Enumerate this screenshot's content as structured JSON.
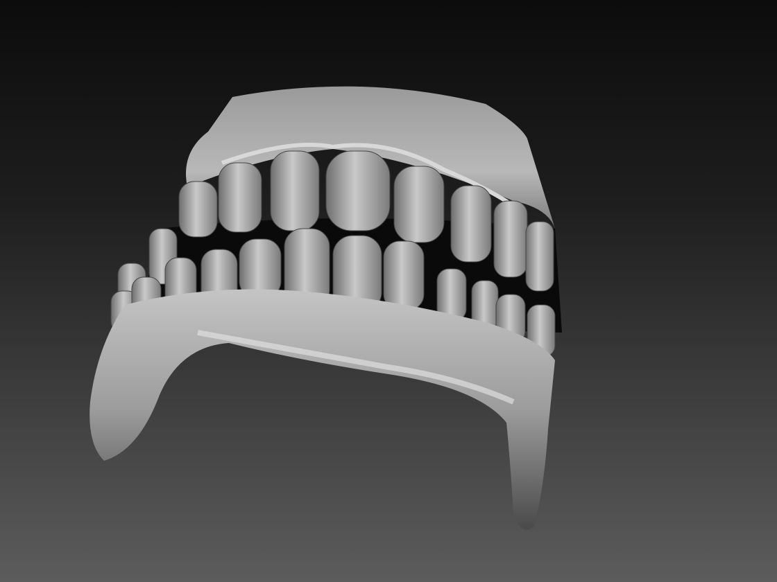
{
  "scene": {
    "subject": "teeth-model",
    "colors": {
      "background_top": "#0c0c0c",
      "background_bottom": "#5c5c5c",
      "surface_light": "#c8c8c8",
      "surface_mid": "#8a8a8a",
      "surface_dark": "#3a3a3a",
      "mouth_interior": "#0a0a0a"
    }
  }
}
